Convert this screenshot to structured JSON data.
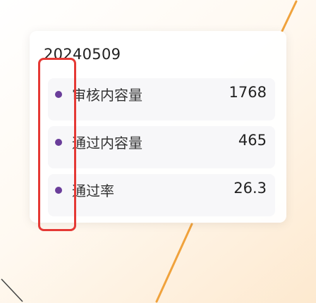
{
  "colors": {
    "dot": "#6a3d9a",
    "highlight_border": "#e53935",
    "accent_line": "#f0a23c"
  },
  "tooltip": {
    "date": "20240509",
    "rows": [
      {
        "label": "审核内容量",
        "value": "1768"
      },
      {
        "label": "通过内容量",
        "value": "465"
      },
      {
        "label": "通过率",
        "value": "26.3"
      }
    ]
  }
}
